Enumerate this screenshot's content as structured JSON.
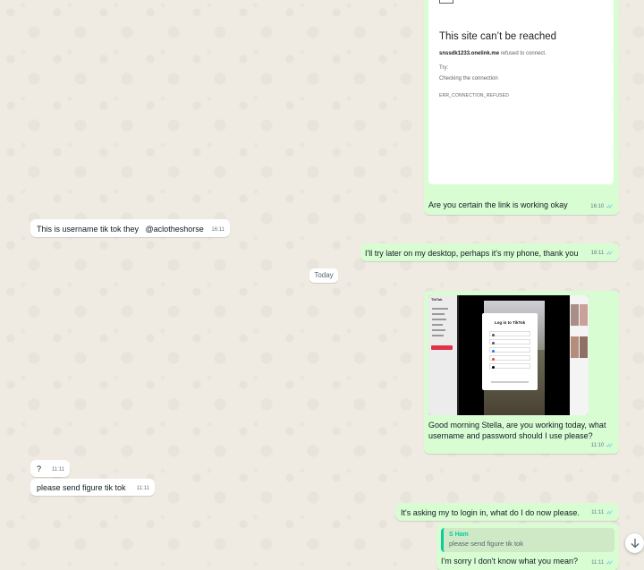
{
  "chat": {
    "date_separator": "Today",
    "messages": [
      {
        "id": "m1",
        "direction": "outgoing",
        "type": "image_with_caption",
        "image": {
          "kind": "browser-error-screenshot",
          "title": "This site can’t be reached",
          "host": "snssdk1233.onelink.me",
          "desc_rest": " refused to connect.",
          "try_label": "Try:",
          "suggestion": "Checking the connection",
          "error_code": "ERR_CONNECTION_REFUSED"
        },
        "caption": "Are you certain the link is working okay",
        "time": "16:10",
        "status": "read"
      },
      {
        "id": "m2",
        "direction": "incoming",
        "text": "This is username tik tok they   @aclotheshorse",
        "time": "16:11"
      },
      {
        "id": "m3",
        "direction": "outgoing",
        "text": "I'll try later on my desktop, perhaps it's my phone, thank you",
        "time": "16:11",
        "status": "read"
      },
      {
        "id": "m4",
        "direction": "outgoing",
        "type": "image_with_caption",
        "image": {
          "kind": "tiktok-login-screenshot",
          "modal_title": "Log in to TikTok",
          "logo_text": "TikTok"
        },
        "caption": "Good morning Stella, are you working today, what username and password should I use please?",
        "time": "11:10",
        "status": "read"
      },
      {
        "id": "m5",
        "direction": "incoming",
        "text": "?",
        "time": "11:11"
      },
      {
        "id": "m6",
        "direction": "incoming",
        "text": "please send figure tik tok",
        "time": "11:11"
      },
      {
        "id": "m7",
        "direction": "outgoing",
        "text": "It's asking my to login in, what do I do now please.",
        "time": "11:11",
        "status": "read"
      },
      {
        "id": "m8",
        "direction": "outgoing",
        "quoted": {
          "author": "S Ham",
          "text": "please send figure tik tok"
        },
        "text": "I'm sorry I don't know what you mean?",
        "time": "11:11",
        "status": "read"
      }
    ]
  },
  "icons": {
    "read_receipt": "double-check-icon",
    "scroll_down": "arrow-down-icon"
  },
  "colors": {
    "chat_background": "#efeae2",
    "outgoing_bubble": "#d9fdd3",
    "incoming_bubble": "#ffffff",
    "read_tick": "#53bdeb",
    "quote_accent": "#06cf9c"
  }
}
